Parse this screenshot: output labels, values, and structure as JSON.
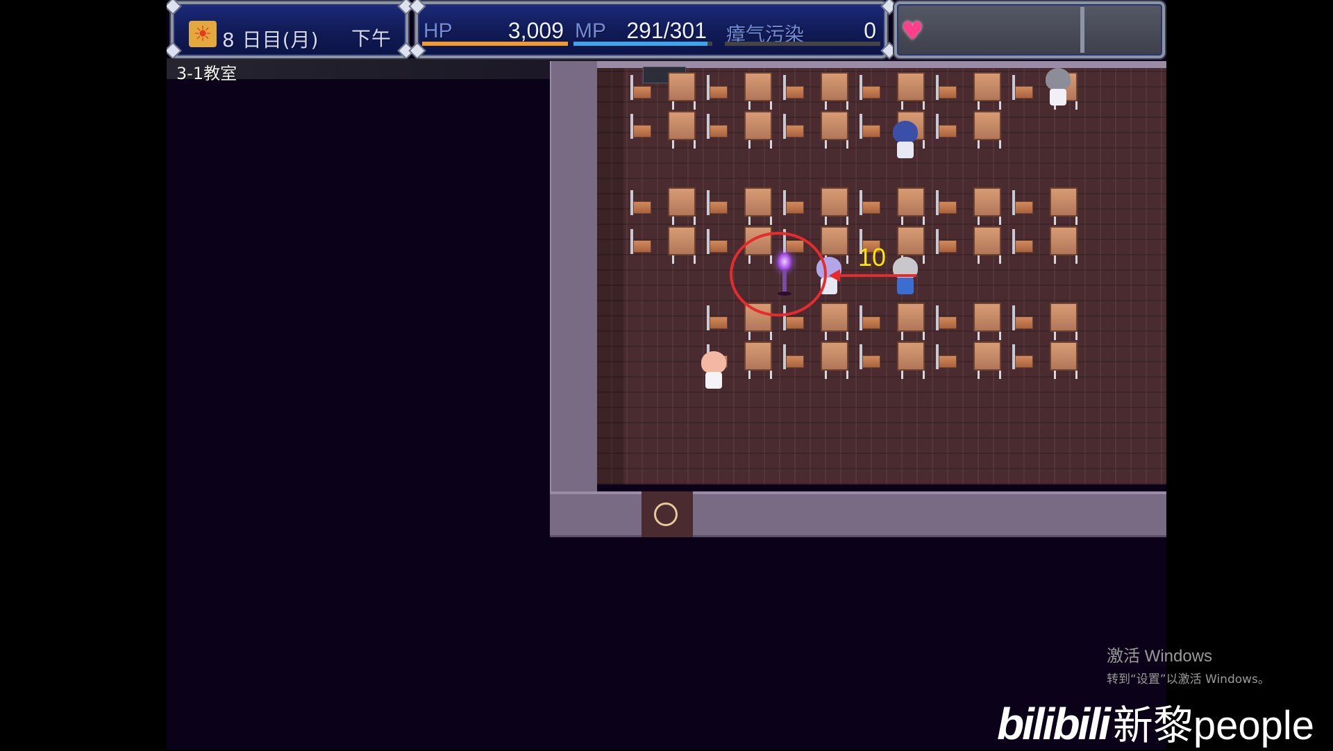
{
  "hud": {
    "day_number": "8",
    "date_text": "日目(月)",
    "time_of_day": "下午",
    "hp_label": "HP",
    "hp_value": "3,009",
    "mp_label": "MP",
    "mp_value": "291/301",
    "mp_fill": 0.967,
    "hp_fill": 1.0,
    "miasma_label": "瘴气污染",
    "miasma_value": "0",
    "miasma_fill": 0.0,
    "icons": [
      "sun-icon",
      "heart-icon"
    ]
  },
  "location": {
    "name": "3-1教室"
  },
  "annotation": {
    "number": "10",
    "color": "#e52b2b",
    "number_color": "#ffe600"
  },
  "overlay": {
    "windows_activate_title": "激活 Windows",
    "windows_activate_sub": "转到“设置”以激活 Windows。",
    "watermark_logo": "bilibili",
    "watermark_user": "新黎people"
  },
  "colors": {
    "hud_panel": "#101a55",
    "hp_bar": "#f29a2e",
    "mp_bar": "#3fa4e8",
    "floor": "#4a2c30",
    "wall": "#7a6b85"
  }
}
